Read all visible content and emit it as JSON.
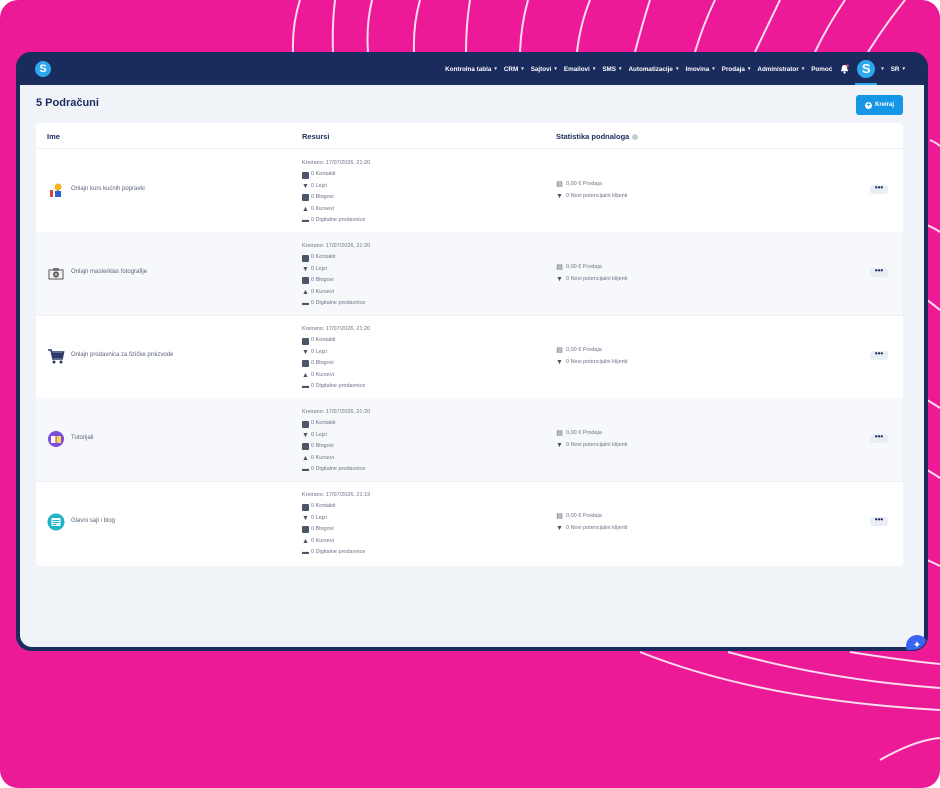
{
  "nav": {
    "items": [
      {
        "label": "Kontrolna tabla",
        "dropdown": true
      },
      {
        "label": "CRM",
        "dropdown": true
      },
      {
        "label": "Sajtovi",
        "dropdown": true
      },
      {
        "label": "Emailovi",
        "dropdown": true
      },
      {
        "label": "SMS",
        "dropdown": true
      },
      {
        "label": "Automatizacije",
        "dropdown": true
      },
      {
        "label": "Imovina",
        "dropdown": true
      },
      {
        "label": "Prodaja",
        "dropdown": true
      },
      {
        "label": "Administrator",
        "dropdown": true
      },
      {
        "label": "Pomoć",
        "dropdown": false
      }
    ],
    "logo_letter": "S",
    "avatar_letter": "S",
    "language": "SR"
  },
  "page": {
    "title": "5 Podračuni",
    "create_label": "Kreiraj"
  },
  "table": {
    "headers": {
      "name": "Ime",
      "resources": "Resursi",
      "stats": "Statistika podnaloga"
    },
    "rows": [
      {
        "name": "Onlajn kurs kućnih popravki",
        "created": "Kreirano: 17/07/2026, 21:20",
        "contacts": "0 Kontakti",
        "funnels": "0 Lejzi",
        "blogs": "0 Blogovi",
        "courses": "0 Kursevi",
        "stores": "0 Digitalne prodavnice",
        "sales": "0,00 € Prodaja",
        "leads": "0 Novi potencijalni klijenti",
        "icon": "tools-icon"
      },
      {
        "name": "Onlajn masterklas fotografije",
        "created": "Kreirano: 17/07/2026, 21:20",
        "contacts": "0 Kontakti",
        "funnels": "0 Lejzi",
        "blogs": "0 Blogovi",
        "courses": "0 Kursevi",
        "stores": "0 Digitalne prodavnice",
        "sales": "0,00 € Prodaja",
        "leads": "0 Novi potencijalni klijenti",
        "icon": "camera-icon"
      },
      {
        "name": "Onlajn prodavnica za fizičke proizvode",
        "created": "Kreirano: 17/07/2026, 21:20",
        "contacts": "0 Kontakti",
        "funnels": "0 Lejzi",
        "blogs": "0 Blogovi",
        "courses": "0 Kursevi",
        "stores": "0 Digitalne prodavnice",
        "sales": "0,00 € Prodaja",
        "leads": "0 Novi potencijalni klijenti",
        "icon": "cart-icon"
      },
      {
        "name": "Tutorijali",
        "created": "Kreirano: 17/07/2026, 21:20",
        "contacts": "0 Kontakti",
        "funnels": "0 Lejzi",
        "blogs": "0 Blogovi",
        "courses": "0 Kursevi",
        "stores": "0 Digitalne prodavnice",
        "sales": "0,00 € Prodaja",
        "leads": "0 Novi potencijalni klijenti",
        "icon": "book-icon"
      },
      {
        "name": "Glavni sajt i blog",
        "created": "Kreirano: 17/07/2026, 21:19",
        "contacts": "0 Kontakti",
        "funnels": "0 Lejzi",
        "blogs": "0 Blogovi",
        "courses": "0 Kursevi",
        "stores": "0 Digitalne prodavnice",
        "sales": "0,00 € Prodaja",
        "leads": "0 Novi potencijalni klijenti",
        "icon": "website-icon"
      }
    ],
    "more_label": "•••"
  },
  "colors": {
    "background": "#ec1a96",
    "navbar": "#1a2b5e",
    "accent": "#1597e5",
    "content": "#f0f3f8"
  }
}
